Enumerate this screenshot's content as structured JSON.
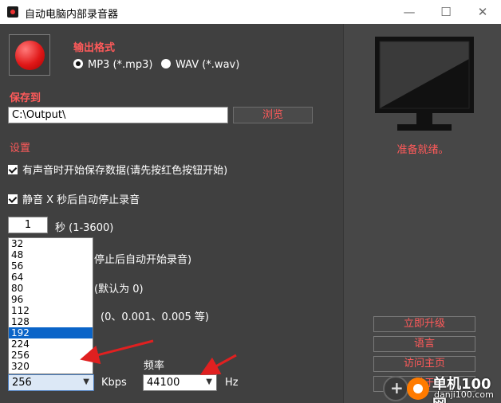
{
  "window": {
    "title": "自动电脑内部录音器",
    "minimize": "—",
    "maximize": "☐",
    "close": "✕"
  },
  "format": {
    "label": "输出格式",
    "mp3": "MP3 (*.mp3)",
    "wav": "WAV (*.wav)",
    "selected": "mp3"
  },
  "save": {
    "label": "保存到",
    "path": "C:\\Output\\",
    "browse": "浏览"
  },
  "settings": {
    "label": "设置",
    "opt1": "有声音时开始保存数据(请先按红色按钮开始)",
    "opt2": "静音 X 秒后自动停止录音",
    "seconds_value": "1",
    "seconds_hint": "秒 (1-3600)",
    "opt3_partial": "停止后自动开始录音)",
    "default_partial": "(默认为 0)",
    "examples_partial": "(0、0.001、0.005 等)"
  },
  "bitrate": {
    "options": [
      "32",
      "48",
      "56",
      "64",
      "80",
      "96",
      "112",
      "128",
      "192",
      "224",
      "256",
      "320"
    ],
    "highlighted": "192",
    "selected": "256",
    "unit": "Kbps"
  },
  "frequency": {
    "label": "频率",
    "selected": "44100",
    "unit": "Hz"
  },
  "side": {
    "status": "准备就绪。",
    "upgrade": "立即升级",
    "language": "语言",
    "homepage": "访问主页",
    "about": "关于"
  },
  "watermark": {
    "title": "单机100网",
    "url": "danji100.com"
  },
  "colors": {
    "accent_red": "#ff5a5a",
    "panel": "#404040",
    "arrow": "#e02020"
  }
}
